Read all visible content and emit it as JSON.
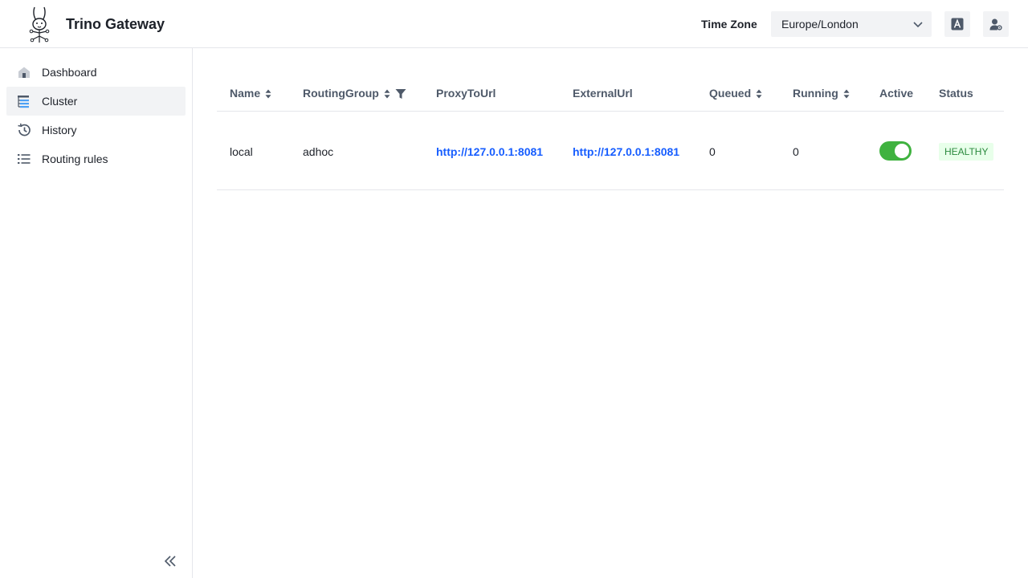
{
  "app": {
    "title": "Trino Gateway"
  },
  "header": {
    "timezone_label": "Time Zone",
    "timezone_value": "Europe/London",
    "icons": [
      "language-icon",
      "user-settings-icon"
    ]
  },
  "sidebar": {
    "items": [
      {
        "label": "Dashboard",
        "icon": "home-icon",
        "active": false
      },
      {
        "label": "Cluster",
        "icon": "cluster-icon",
        "active": true
      },
      {
        "label": "History",
        "icon": "history-icon",
        "active": false
      },
      {
        "label": "Routing rules",
        "icon": "list-icon",
        "active": false
      }
    ]
  },
  "table": {
    "columns": [
      {
        "label": "Name",
        "sortable": true
      },
      {
        "label": "RoutingGroup",
        "sortable": true,
        "filterable": true
      },
      {
        "label": "ProxyToUrl"
      },
      {
        "label": "ExternalUrl"
      },
      {
        "label": "Queued",
        "sortable": true
      },
      {
        "label": "Running",
        "sortable": true
      },
      {
        "label": "Active"
      },
      {
        "label": "Status"
      }
    ],
    "rows": [
      {
        "name": "local",
        "routing_group": "adhoc",
        "proxy_to_url": "http://127.0.0.1:8081",
        "external_url": "http://127.0.0.1:8081",
        "queued": "0",
        "running": "0",
        "active": true,
        "status": "HEALTHY"
      }
    ]
  },
  "colors": {
    "accent": "#165dff",
    "toggle_on": "#3fb23f",
    "healthy_bg": "#e8ffea",
    "healthy_text": "#2b8a3e"
  }
}
